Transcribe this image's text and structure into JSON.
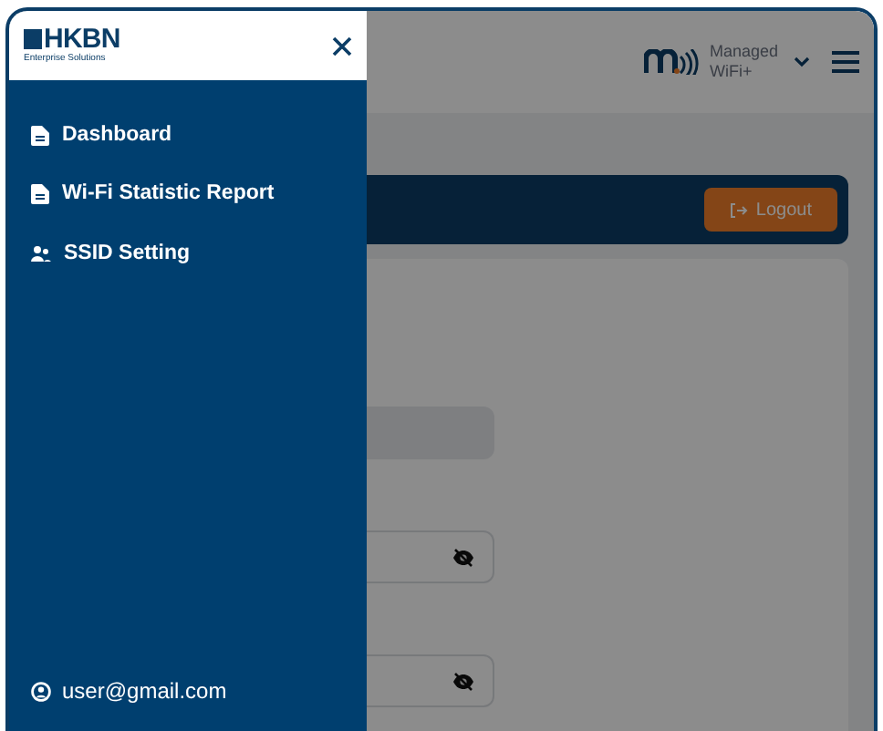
{
  "sidebar": {
    "logo": {
      "name": "HKBN",
      "tagline": "Enterprise Solutions"
    },
    "items": [
      {
        "label": "Dashboard",
        "kind": "document"
      },
      {
        "label": "Wi-Fi Statistic Report",
        "kind": "document"
      },
      {
        "label": "SSID Setting",
        "kind": "users"
      }
    ],
    "user": "user@gmail.com"
  },
  "header": {
    "product": "Managed WiFi+"
  },
  "toolbar": {
    "logout": "Logout"
  },
  "form": {
    "fields": [
      {
        "kind": "disabled"
      },
      {
        "kind": "password"
      },
      {
        "kind": "password"
      }
    ]
  }
}
